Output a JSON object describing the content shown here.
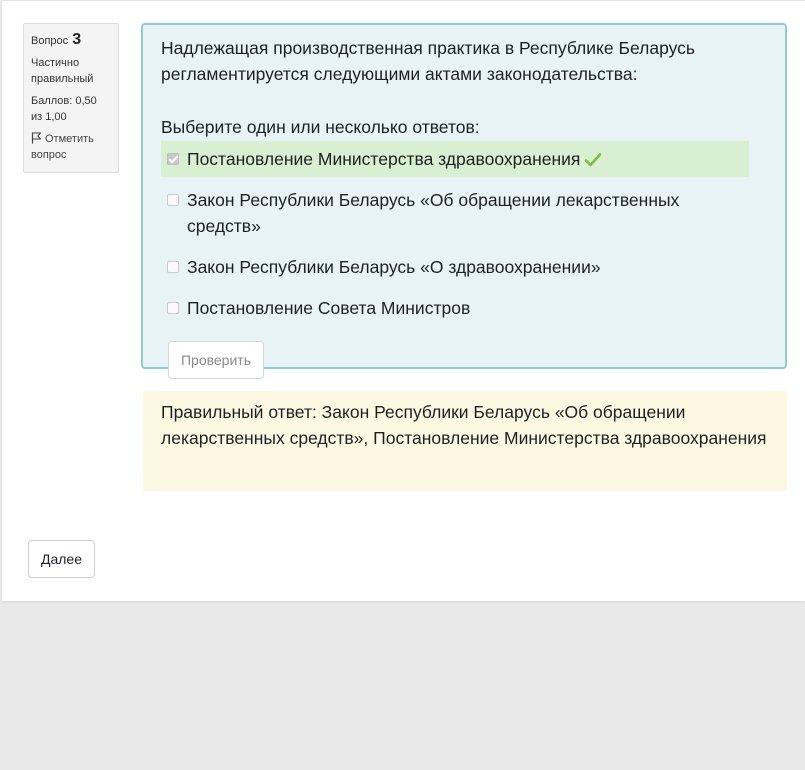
{
  "info": {
    "question_word": "Вопрос",
    "question_number": "3",
    "state": "Частично правильный",
    "grade": "Баллов: 0,50 из 1,00",
    "flag_label": "Отметить вопрос",
    "flag_icon": "flag-icon"
  },
  "question": {
    "text": "Надлежащая производственная практика в Республике Беларусь регламентируется следующими актами законодательства:",
    "prompt": "Выберите один или несколько ответов:",
    "options": [
      {
        "label": "Постановление Министерства здравоохранения",
        "checked": true,
        "status": "correct"
      },
      {
        "label": "Закон Республики Беларусь «Об обращении лекарственных средств»",
        "checked": false,
        "status": ""
      },
      {
        "label": "Закон Республики Беларусь «О здравоохранении»",
        "checked": false,
        "status": ""
      },
      {
        "label": "Постановление Совета Министров",
        "checked": false,
        "status": ""
      }
    ],
    "check_button": "Проверить"
  },
  "feedback": {
    "right_answer": "Правильный ответ: Закон Республики Беларусь «Об обращении лекарственных средств», Постановление Министерства здравоохранения"
  },
  "navigation": {
    "next_button": "Далее"
  },
  "colors": {
    "formulation_bg": "#e7f3f5",
    "formulation_border": "#8dcbd5",
    "correct_bg": "#d9efd1",
    "correct_tick": "#7cbf3a",
    "outcome_bg": "#fcf8e1"
  }
}
